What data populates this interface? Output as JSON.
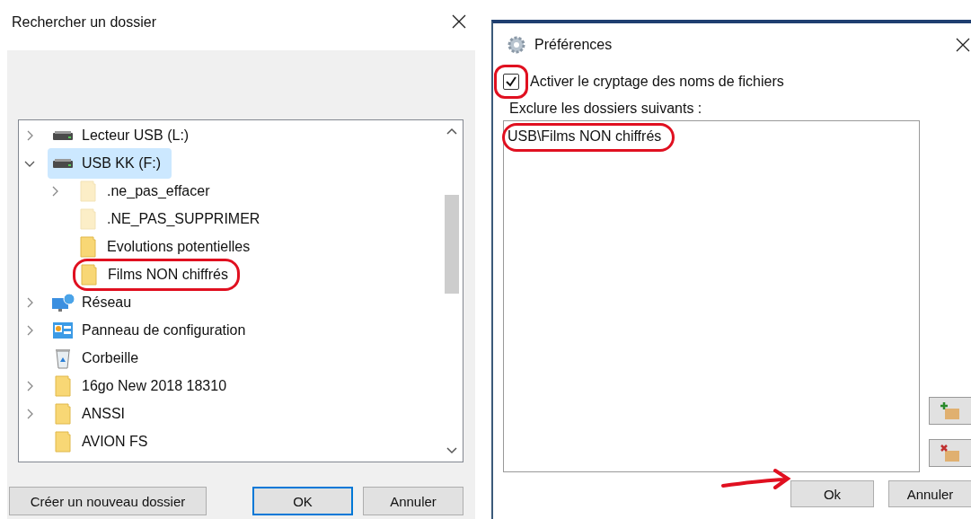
{
  "folder_dialog": {
    "title": "Rechercher un dossier",
    "tree": [
      {
        "label": "Lecteur USB (L:)",
        "kind": "drive",
        "expandable": true,
        "expanded": false,
        "selected": false,
        "faded": false,
        "circled": false
      },
      {
        "label": "USB KK (F:)",
        "kind": "drive",
        "expandable": true,
        "expanded": true,
        "selected": true,
        "faded": false,
        "circled": false,
        "children": [
          {
            "label": ".ne_pas_effacer",
            "kind": "folder",
            "expandable": true,
            "expanded": false,
            "selected": false,
            "faded": true,
            "circled": false
          },
          {
            "label": ".NE_PAS_SUPPRIMER",
            "kind": "folder",
            "expandable": false,
            "selected": false,
            "faded": true,
            "circled": false
          },
          {
            "label": "Evolutions potentielles",
            "kind": "folder",
            "expandable": false,
            "selected": false,
            "faded": false,
            "circled": false
          },
          {
            "label": "Films NON chiffrés",
            "kind": "folder",
            "expandable": false,
            "selected": false,
            "faded": false,
            "circled": true
          }
        ]
      },
      {
        "label": "Réseau",
        "kind": "network",
        "expandable": true,
        "expanded": false,
        "selected": false,
        "faded": false,
        "circled": false
      },
      {
        "label": "Panneau de configuration",
        "kind": "control-panel",
        "expandable": true,
        "expanded": false,
        "selected": false,
        "faded": false,
        "circled": false
      },
      {
        "label": "Corbeille",
        "kind": "recycle-bin",
        "expandable": false,
        "selected": false,
        "faded": false,
        "circled": false
      },
      {
        "label": "16go New 2018  18310",
        "kind": "folder",
        "expandable": true,
        "expanded": false,
        "selected": false,
        "faded": false,
        "circled": false
      },
      {
        "label": "ANSSI",
        "kind": "folder",
        "expandable": true,
        "expanded": false,
        "selected": false,
        "faded": false,
        "circled": false
      },
      {
        "label": "AVION  FS",
        "kind": "folder",
        "expandable": false,
        "selected": false,
        "faded": false,
        "circled": false
      }
    ],
    "buttons": [
      {
        "label": "Créer un nouveau dossier",
        "default": false
      },
      {
        "label": "OK",
        "default": true
      },
      {
        "label": "Annuler",
        "default": false
      }
    ]
  },
  "preferences_dialog": {
    "title": "Préférences",
    "checkbox": {
      "label": "Activer le cryptage des noms de fichiers",
      "checked": true,
      "circled": true
    },
    "exclude_label": "Exclure les dossiers suivants :",
    "excluded": [
      {
        "path": "USB\\Films NON chiffrés",
        "circled": true
      }
    ],
    "buttons": [
      {
        "label": "Ok",
        "arrow": true
      },
      {
        "label": "Annuler",
        "arrow": false
      }
    ]
  }
}
